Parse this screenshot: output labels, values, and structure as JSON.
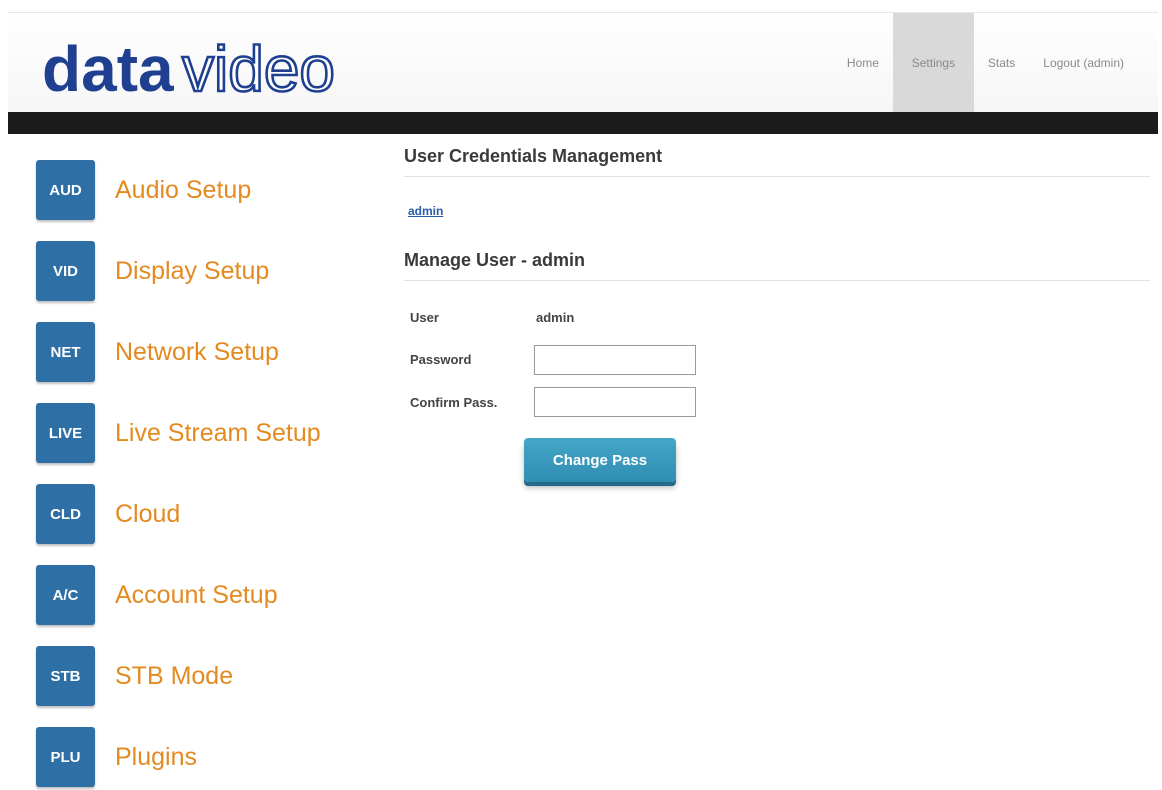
{
  "brand": {
    "logo_bold": "data",
    "logo_outline": "video",
    "logo_color": "#1f3f91"
  },
  "topnav": {
    "items": [
      {
        "label": "Home"
      },
      {
        "label": "Settings",
        "active": true
      },
      {
        "label": "Stats"
      },
      {
        "label": "Logout (admin)"
      }
    ]
  },
  "sidebar": {
    "badge_color": "#2e6fa6",
    "label_color": "#e38a20",
    "items": [
      {
        "badge": "AUD",
        "label": "Audio Setup"
      },
      {
        "badge": "VID",
        "label": "Display Setup"
      },
      {
        "badge": "NET",
        "label": "Network Setup"
      },
      {
        "badge": "LIVE",
        "label": "Live Stream Setup"
      },
      {
        "badge": "CLD",
        "label": "Cloud"
      },
      {
        "badge": "A/C",
        "label": "Account Setup"
      },
      {
        "badge": "STB",
        "label": "STB Mode"
      },
      {
        "badge": "PLU",
        "label": "Plugins"
      }
    ]
  },
  "main": {
    "credentials_title": "User Credentials Management",
    "user_link": "admin",
    "manage_title": "Manage User - admin",
    "form": {
      "user_label": "User",
      "user_value": "admin",
      "password_label": "Password",
      "password_value": "",
      "confirm_label": "Confirm Pass.",
      "confirm_value": "",
      "submit_label": "Change Pass"
    }
  }
}
